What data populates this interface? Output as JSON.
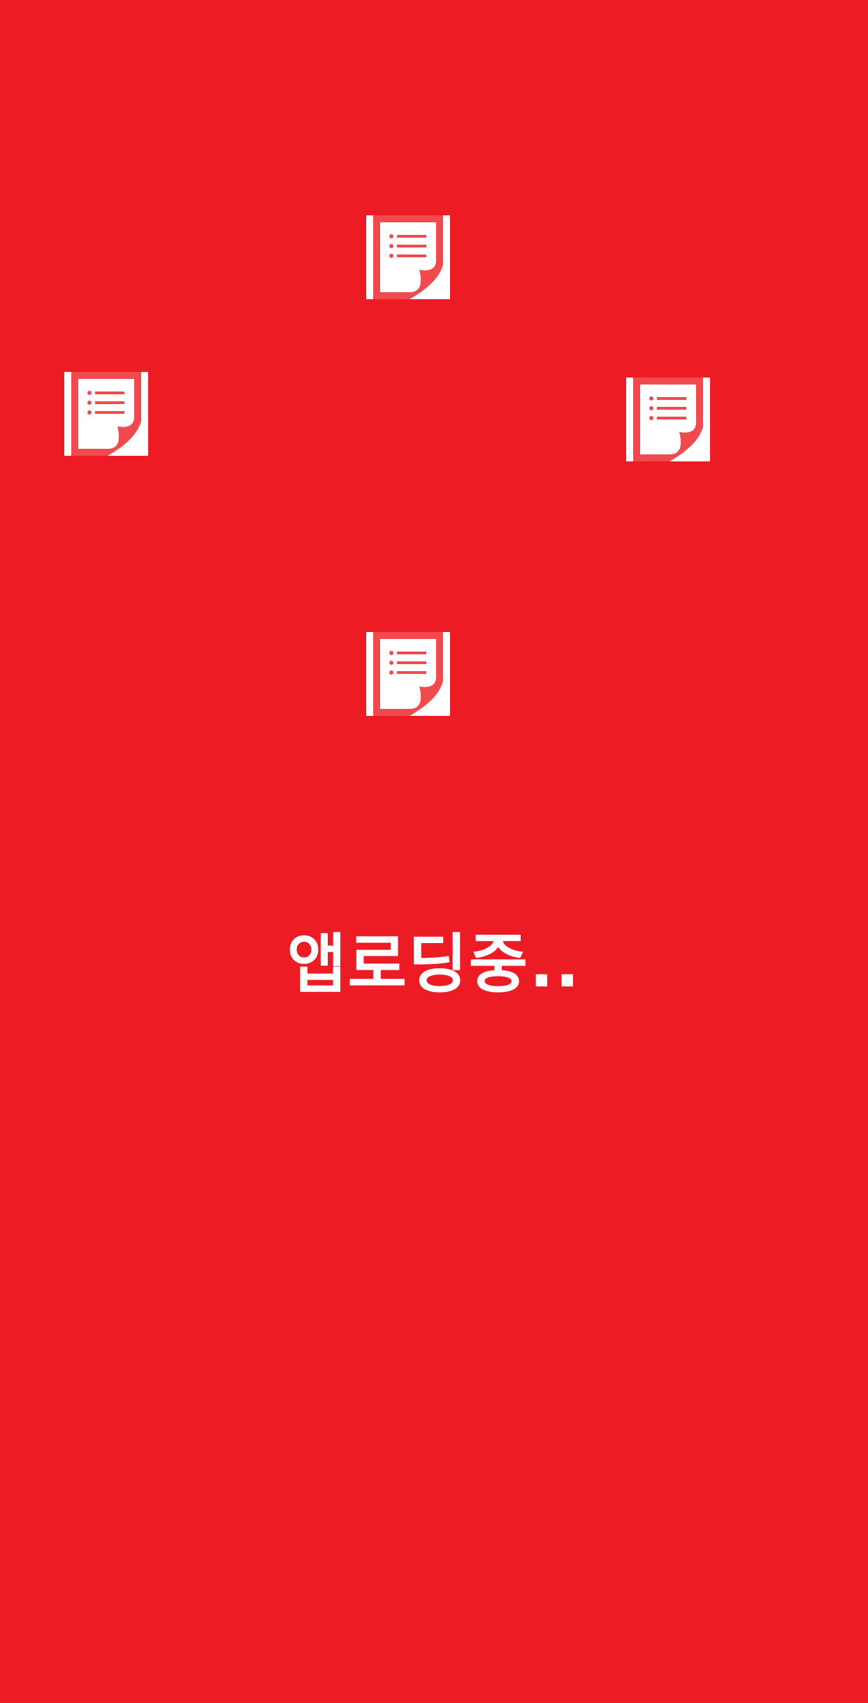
{
  "theme": {
    "background_color": "#ed1c24",
    "foreground_color": "#ffffff",
    "icon_accent_color": "#f04a4f"
  },
  "splash": {
    "icons": [
      {
        "name": "document-list-icon"
      },
      {
        "name": "document-list-icon"
      },
      {
        "name": "document-list-icon"
      },
      {
        "name": "document-list-icon"
      }
    ],
    "loading_text": "앱로딩중.."
  }
}
